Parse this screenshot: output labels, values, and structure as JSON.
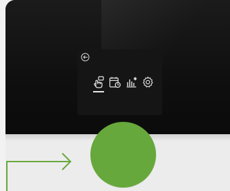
{
  "device": {
    "menu": {
      "back_icon": "arrow-left-circle-icon",
      "icons": [
        "hand-pointer-icon",
        "calendar-clock-icon",
        "bar-chart-icon",
        "gear-icon"
      ],
      "selected": "hand-pointer-icon"
    }
  },
  "colors": {
    "screen": "#0f0f0f",
    "panel": "#151515",
    "icon": "#e6e6e6",
    "knob": "#67a83c",
    "arrow": "#67a83c",
    "background": "#f2f2f2"
  }
}
